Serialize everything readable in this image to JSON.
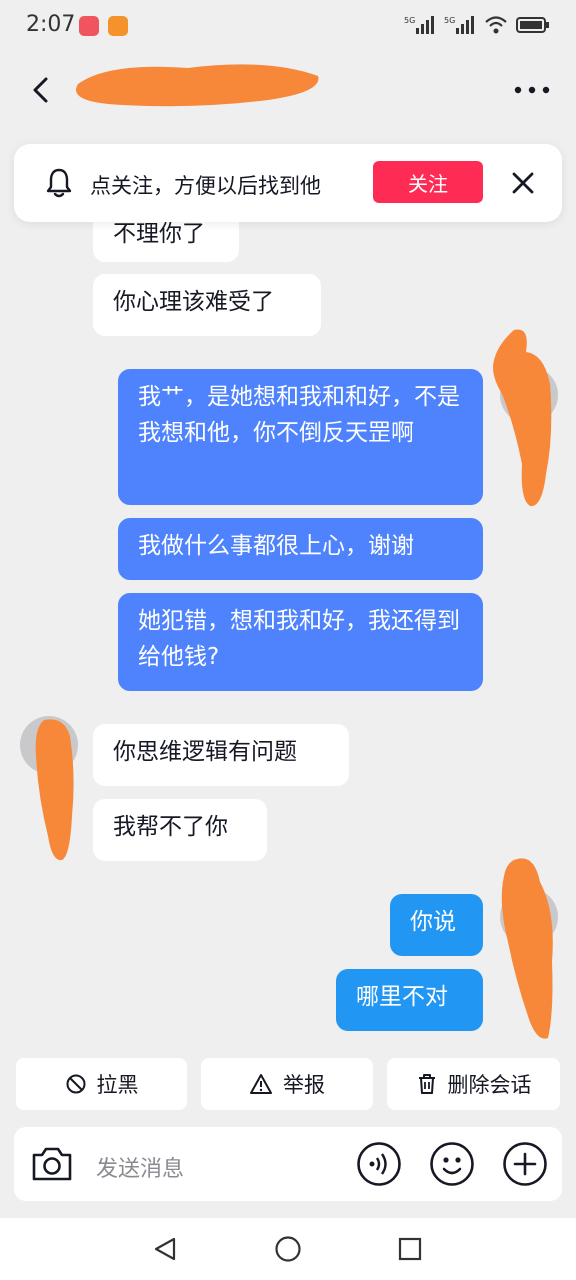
{
  "status_bar": {
    "time": "2:07",
    "signal_1": "5G",
    "signal_2": "5G"
  },
  "header": {
    "back_icon": "chevron-left-icon",
    "more_icon": "more-horizontal-icon"
  },
  "follow_banner": {
    "icon": "bell-icon",
    "text": "点关注，方便以后找到他",
    "button": "关注",
    "close_icon": "close-icon"
  },
  "messages": {
    "m1": "不理你了",
    "m2": "你心理该难受了",
    "m3": "我艹，是她想和我和和好，不是我想和他，你不倒反天罡啊",
    "m4": "我做什么事都很上心，谢谢",
    "m5": "她犯错，想和我和好，我还得到给他钱?",
    "m6": "你思维逻辑有问题",
    "m7": "我帮不了你",
    "m8": "你说",
    "m9": "哪里不对"
  },
  "actions": {
    "block": "拉黑",
    "report": "举报",
    "delete": "删除会话"
  },
  "input": {
    "placeholder": "发送消息"
  },
  "colors": {
    "accent_red": "#fe2c55",
    "bubble_blue": "#4e83fd",
    "bubble_blue_alt": "#2196f3",
    "redaction_orange": "#f7883a"
  }
}
